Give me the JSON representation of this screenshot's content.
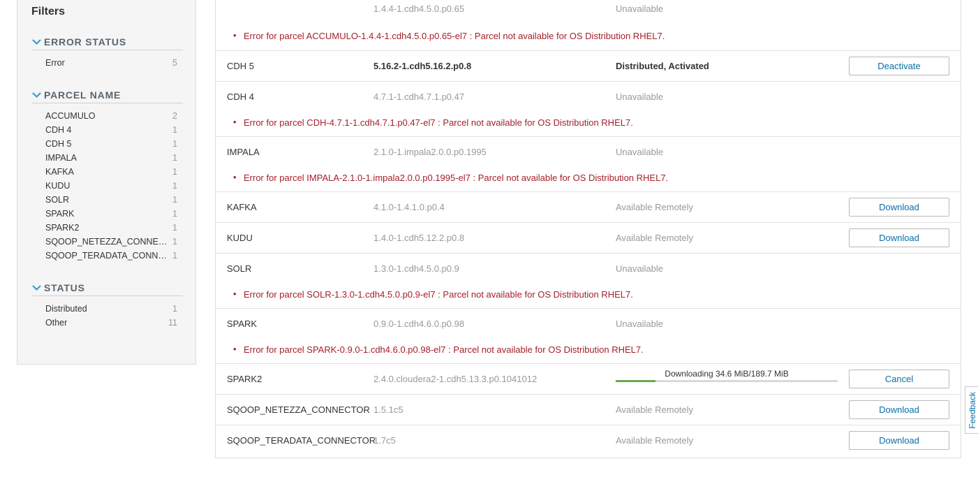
{
  "sidebar": {
    "title": "Filters",
    "sections": [
      {
        "header": "ERROR STATUS",
        "items": [
          {
            "label": "Error",
            "count": "5"
          }
        ]
      },
      {
        "header": "PARCEL NAME",
        "items": [
          {
            "label": "ACCUMULO",
            "count": "2"
          },
          {
            "label": "CDH 4",
            "count": "1"
          },
          {
            "label": "CDH 5",
            "count": "1"
          },
          {
            "label": "IMPALA",
            "count": "1"
          },
          {
            "label": "KAFKA",
            "count": "1"
          },
          {
            "label": "KUDU",
            "count": "1"
          },
          {
            "label": "SOLR",
            "count": "1"
          },
          {
            "label": "SPARK",
            "count": "1"
          },
          {
            "label": "SPARK2",
            "count": "1"
          },
          {
            "label": "SQOOP_NETEZZA_CONNECTOR",
            "count": "1"
          },
          {
            "label": "SQOOP_TERADATA_CONNECTOR",
            "count": "1"
          }
        ]
      },
      {
        "header": "STATUS",
        "items": [
          {
            "label": "Distributed",
            "count": "1"
          },
          {
            "label": "Other",
            "count": "11"
          }
        ]
      }
    ]
  },
  "parcels": [
    {
      "name": "",
      "version": "1.4.4-1.cdh4.5.0.p0.65",
      "status": "Unavailable",
      "error": "Error for parcel ACCUMULO-1.4.4-1.cdh4.5.0.p0.65-el7 : Parcel not available for OS Distribution RHEL7."
    },
    {
      "name": "CDH 5",
      "version": "5.16.2-1.cdh5.16.2.p0.8",
      "status": "Distributed, Activated",
      "emphasis": true,
      "action": "Deactivate"
    },
    {
      "name": "CDH 4",
      "version": "4.7.1-1.cdh4.7.1.p0.47",
      "status": "Unavailable",
      "error": "Error for parcel CDH-4.7.1-1.cdh4.7.1.p0.47-el7 : Parcel not available for OS Distribution RHEL7."
    },
    {
      "name": "IMPALA",
      "version": "2.1.0-1.impala2.0.0.p0.1995",
      "status": "Unavailable",
      "error": "Error for parcel IMPALA-2.1.0-1.impala2.0.0.p0.1995-el7 : Parcel not available for OS Distribution RHEL7."
    },
    {
      "name": "KAFKA",
      "version": "4.1.0-1.4.1.0.p0.4",
      "status": "Available Remotely",
      "action": "Download"
    },
    {
      "name": "KUDU",
      "version": "1.4.0-1.cdh5.12.2.p0.8",
      "status": "Available Remotely",
      "action": "Download"
    },
    {
      "name": "SOLR",
      "version": "1.3.0-1.cdh4.5.0.p0.9",
      "status": "Unavailable",
      "error": "Error for parcel SOLR-1.3.0-1.cdh4.5.0.p0.9-el7 : Parcel not available for OS Distribution RHEL7."
    },
    {
      "name": "SPARK",
      "version": "0.9.0-1.cdh4.6.0.p0.98",
      "status": "Unavailable",
      "error": "Error for parcel SPARK-0.9.0-1.cdh4.6.0.p0.98-el7 : Parcel not available for OS Distribution RHEL7."
    },
    {
      "name": "SPARK2",
      "version": "2.4.0.cloudera2-1.cdh5.13.3.p0.1041012",
      "progress_text": "Downloading 34.6 MiB/189.7 MiB",
      "progress_fraction": 0.18,
      "action": "Cancel"
    },
    {
      "name": "SQOOP_NETEZZA_CONNECTOR",
      "version": "1.5.1c5",
      "status": "Available Remotely",
      "action": "Download"
    },
    {
      "name": "SQOOP_TERADATA_CONNECTOR",
      "version": "1.7c5",
      "status": "Available Remotely",
      "action": "Download"
    }
  ],
  "feedback": {
    "label": "Feedback"
  },
  "colors": {
    "link": "#0a6ea5",
    "error": "#a41f28",
    "progress": "#6aa84f"
  }
}
